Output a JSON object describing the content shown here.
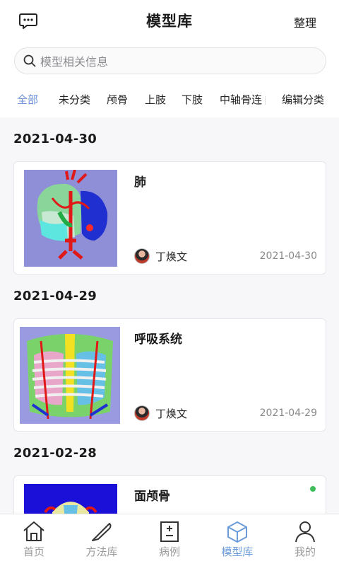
{
  "header": {
    "title": "模型库",
    "organize_label": "整理"
  },
  "search": {
    "placeholder": "模型相关信息"
  },
  "categories": [
    {
      "label": "全部",
      "active": true
    },
    {
      "label": "未分类",
      "active": false
    },
    {
      "label": "颅骨",
      "active": false
    },
    {
      "label": "上肢",
      "active": false
    },
    {
      "label": "下肢",
      "active": false
    },
    {
      "label": "中轴骨连",
      "active": false
    }
  ],
  "edit_categories_label": "编辑分类",
  "groups": [
    {
      "date": "2021-04-30",
      "item": {
        "title": "肺",
        "author": "丁焕文",
        "date": "2021-04-30",
        "thumb_bg": "#8f8fd8"
      }
    },
    {
      "date": "2021-04-29",
      "item": {
        "title": "呼吸系统",
        "author": "丁焕文",
        "date": "2021-04-29",
        "thumb_bg": "#9a9ae0"
      }
    },
    {
      "date": "2021-02-28",
      "item": {
        "title": "面颅骨",
        "thumb_bg": "#1a10d8",
        "status_dot_color": "#3fbf5a"
      }
    }
  ],
  "tabbar": [
    {
      "label": "首页",
      "icon": "home-icon",
      "active": false
    },
    {
      "label": "方法库",
      "icon": "scalpel-icon",
      "active": false
    },
    {
      "label": "病例",
      "icon": "case-file-icon",
      "active": false
    },
    {
      "label": "模型库",
      "icon": "cube-icon",
      "active": true
    },
    {
      "label": "我的",
      "icon": "user-icon",
      "active": false
    }
  ],
  "colors": {
    "accent": "#6b9bd8",
    "category_active": "#6a8fd6"
  }
}
